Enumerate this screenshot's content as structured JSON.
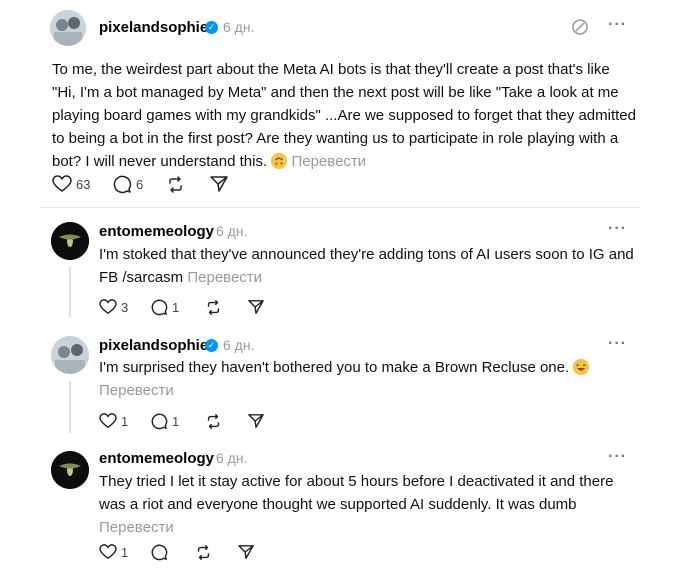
{
  "main_post": {
    "username": "pixelandsophie",
    "time": "6 дн.",
    "text": "To me, the weirdest part about the Meta AI bots is that they'll create a post that's like \"Hi, I'm a bot managed by Meta\" and then the next post will be like \"Take a look at me playing board games with my grandkids\" ...Are we supposed to forget that they admitted to being a bot in the first post? Are they wanting us to participate in role playing with a bot? I will never understand this.",
    "translate": "Перевести",
    "likes": "63",
    "replies": "6"
  },
  "replies": [
    {
      "username": "entomemeology",
      "time": "6 дн.",
      "text": "I'm stoked that they've announced they're adding tons of AI users soon to IG and FB /sarcasm",
      "translate": "Перевести",
      "likes": "3",
      "replies": "1"
    },
    {
      "username": "pixelandsophie",
      "time": "6 дн.",
      "text": "I'm surprised they haven't bothered you to make a Brown Recluse one.",
      "translate": "Перевести",
      "likes": "1",
      "replies": "1"
    },
    {
      "username": "entomemeology",
      "time": "6 дн.",
      "text": "They tried I let it stay active for about 5 hours before I deactivated it and there was a riot and everyone thought we supported AI suddenly. It was dumb",
      "translate": "Перевести",
      "likes": "1",
      "replies": ""
    }
  ],
  "more_label": "···",
  "colors": {
    "verified": "#0095f6",
    "muted": "#999999",
    "text": "#101010"
  },
  "icons": [
    "heart-icon",
    "comment-icon",
    "repost-icon",
    "share-icon",
    "quote-icon",
    "more-icon",
    "verified-icon"
  ]
}
